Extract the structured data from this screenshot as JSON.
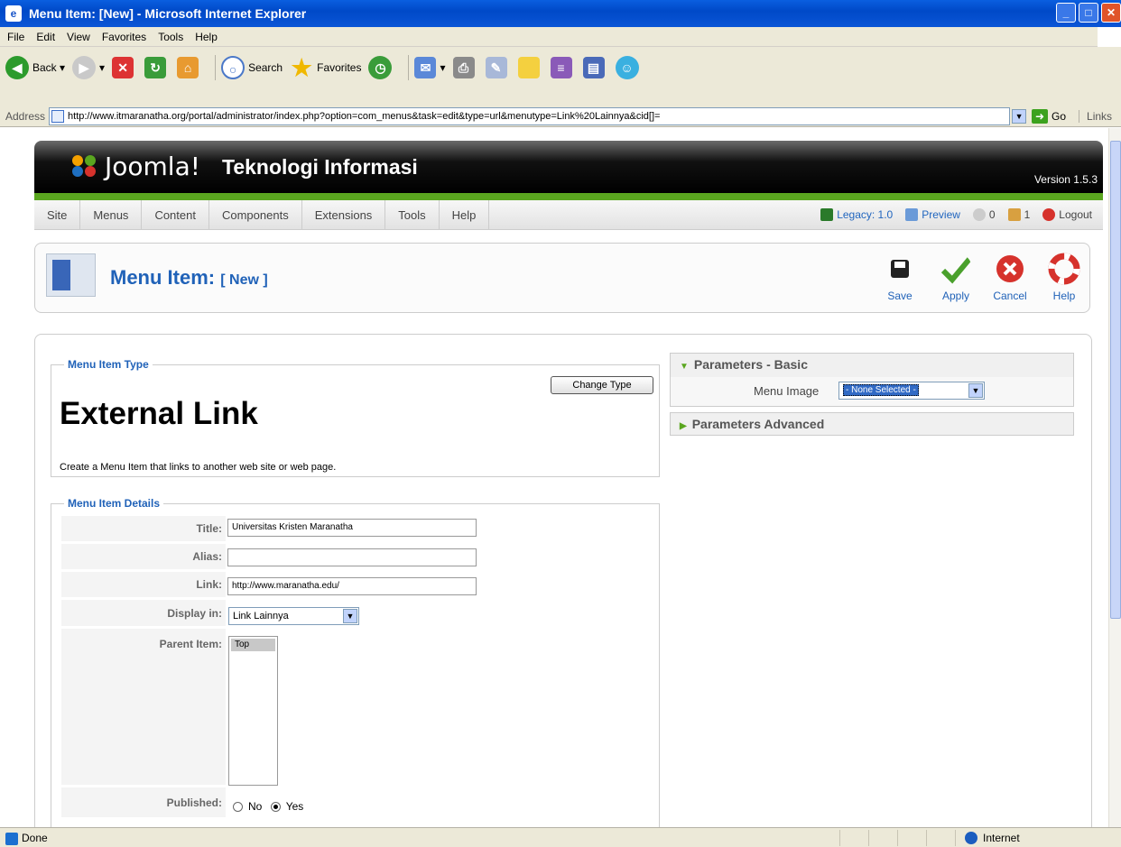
{
  "window": {
    "title": "Menu Item: [New] - Microsoft Internet Explorer"
  },
  "menubar": {
    "items": [
      "File",
      "Edit",
      "View",
      "Favorites",
      "Tools",
      "Help"
    ]
  },
  "toolbar": {
    "back": "Back",
    "search": "Search",
    "favorites": "Favorites"
  },
  "address": {
    "label": "Address",
    "url": "http://www.itmaranatha.org/portal/administrator/index.php?option=com_menus&task=edit&type=url&menutype=Link%20Lainnya&cid[]=",
    "go": "Go",
    "links": "Links"
  },
  "joomla": {
    "brand": "Joomla!",
    "site_name": "Teknologi Informasi",
    "version": "Version 1.5.3",
    "menu": [
      "Site",
      "Menus",
      "Content",
      "Components",
      "Extensions",
      "Tools",
      "Help"
    ],
    "legacy": "Legacy: 1.0",
    "preview": "Preview",
    "messages": "0",
    "users": "1",
    "logout": "Logout"
  },
  "page": {
    "title": "Menu Item:",
    "title_sub": "[ New ]",
    "buttons": {
      "save": "Save",
      "apply": "Apply",
      "cancel": "Cancel",
      "help": "Help"
    }
  },
  "item_type": {
    "legend": "Menu Item Type",
    "change_button": "Change Type",
    "type_name": "External Link",
    "description": "Create a Menu Item that links to another web site or web page."
  },
  "details": {
    "legend": "Menu Item Details",
    "title_label": "Title:",
    "title_value": "Universitas Kristen Maranatha",
    "alias_label": "Alias:",
    "alias_value": "",
    "link_label": "Link:",
    "link_value": "http://www.maranatha.edu/",
    "display_label": "Display in:",
    "display_value": "Link Lainnya",
    "parent_label": "Parent Item:",
    "parent_option": "Top",
    "published_label": "Published:",
    "published_no": "No",
    "published_yes": "Yes"
  },
  "params": {
    "basic_title": "Parameters - Basic",
    "menu_image_label": "Menu Image",
    "menu_image_value": "- None Selected -",
    "advanced_title": "Parameters Advanced"
  },
  "status": {
    "text": "Done",
    "zone": "Internet"
  }
}
